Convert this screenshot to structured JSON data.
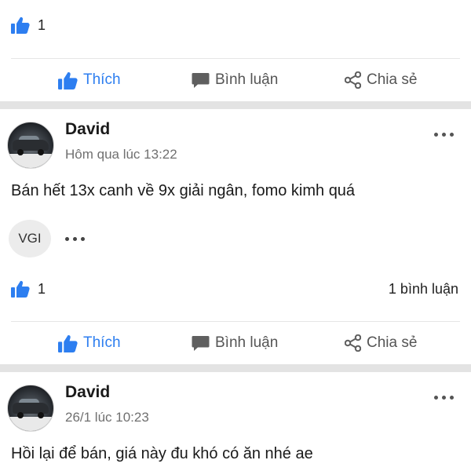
{
  "top_bar": {
    "like_count": "1"
  },
  "actions": {
    "like": "Thích",
    "comment": "Bình luận",
    "share": "Chia sẻ"
  },
  "posts": [
    {
      "author": "David",
      "time": "Hôm qua lúc 13:22",
      "text": "Bán hết 13x canh về 9x giải ngân, fomo kimh quá",
      "reaction_label": "VGI",
      "like_count": "1",
      "comment_count": "1 bình luận"
    },
    {
      "author": "David",
      "time": "26/1 lúc 10:23",
      "text": "Hồi lại để bán, giá này đu khó có ăn nhé ae"
    }
  ],
  "colors": {
    "accent": "#2d7ef0",
    "separator": "#e3e3e3",
    "muted_text": "#707070"
  },
  "icons": {
    "like": "thumbs-up-icon",
    "comment": "speech-bubble-icon",
    "share": "share-icon",
    "more": "more-dots-icon"
  }
}
